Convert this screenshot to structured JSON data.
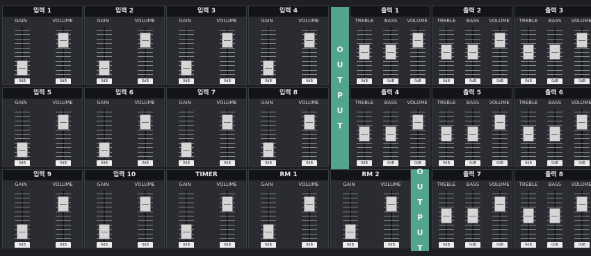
{
  "labels": {
    "gain": "GAIN",
    "volume": "VOLUME",
    "treble": "TREBLE",
    "bass": "BASS",
    "value": "0dB"
  },
  "output_bars": {
    "main_letters": [
      "O",
      "U",
      "T",
      "P",
      "U",
      "T"
    ],
    "lower_letters": [
      "O",
      "U",
      "T",
      "P",
      "U",
      "T"
    ]
  },
  "input_panels": [
    {
      "title": "입력 1",
      "gain_level": 0.05,
      "volume_level": 0.85,
      "value": "0dB"
    },
    {
      "title": "입력 2",
      "gain_level": 0.05,
      "volume_level": 0.85,
      "value": "0dB"
    },
    {
      "title": "입력 3",
      "gain_level": 0.05,
      "volume_level": 0.85,
      "value": "0dB"
    },
    {
      "title": "입력 4",
      "gain_level": 0.05,
      "volume_level": 0.85,
      "value": "0dB"
    },
    {
      "title": "입력 5",
      "gain_level": 0.05,
      "volume_level": 0.85,
      "value": "0dB"
    },
    {
      "title": "입력 6",
      "gain_level": 0.05,
      "volume_level": 0.85,
      "value": "0dB"
    },
    {
      "title": "입력 7",
      "gain_level": 0.05,
      "volume_level": 0.85,
      "value": "0dB"
    },
    {
      "title": "입력 8",
      "gain_level": 0.05,
      "volume_level": 0.85,
      "value": "0dB"
    },
    {
      "title": "입력 9",
      "gain_level": 0.05,
      "volume_level": 0.85,
      "value": "0dB"
    },
    {
      "title": "입력 10",
      "gain_level": 0.05,
      "volume_level": 0.85,
      "value": "0dB"
    },
    {
      "title": "TIMER",
      "gain_level": 0.05,
      "volume_level": 0.85,
      "value": "0dB"
    },
    {
      "title": "RM 1",
      "gain_level": 0.05,
      "volume_level": 0.85,
      "value": "0dB"
    },
    {
      "title": "RM 2",
      "gain_level": 0.05,
      "volume_level": 0.85,
      "value": "0dB"
    }
  ],
  "output_panels": [
    {
      "title": "출력 1",
      "treble_level": 0.5,
      "bass_level": 0.5,
      "volume_level": 0.85,
      "values": [
        "0dB",
        "0dB",
        "0dB"
      ]
    },
    {
      "title": "출력 2",
      "treble_level": 0.5,
      "bass_level": 0.5,
      "volume_level": 0.85,
      "values": [
        "0dB",
        "0dB",
        "0dB"
      ]
    },
    {
      "title": "출력 3",
      "treble_level": 0.5,
      "bass_level": 0.5,
      "volume_level": 0.85,
      "values": [
        "0dB",
        "0dB",
        "0dB"
      ]
    },
    {
      "title": "출력 4",
      "treble_level": 0.5,
      "bass_level": 0.5,
      "volume_level": 0.85,
      "values": [
        "0dB",
        "0dB",
        "0dB"
      ]
    },
    {
      "title": "출력 5",
      "treble_level": 0.5,
      "bass_level": 0.5,
      "volume_level": 0.85,
      "values": [
        "0dB",
        "0dB",
        "0dB"
      ]
    },
    {
      "title": "출력 6",
      "treble_level": 0.5,
      "bass_level": 0.5,
      "volume_level": 0.85,
      "values": [
        "0dB",
        "0dB",
        "0dB"
      ]
    },
    {
      "title": "출력 7",
      "treble_level": 0.5,
      "bass_level": 0.5,
      "volume_level": 0.85,
      "values": [
        "0dB",
        "0dB",
        "0dB"
      ]
    },
    {
      "title": "출력 8",
      "treble_level": 0.5,
      "bass_level": 0.5,
      "volume_level": 0.85,
      "values": [
        "0dB",
        "0dB",
        "0dB"
      ]
    }
  ],
  "colors": {
    "accent": "#52a48f",
    "panel": "#2a2c31",
    "title_bar": "#131417",
    "knob": "#d6d6d6"
  }
}
